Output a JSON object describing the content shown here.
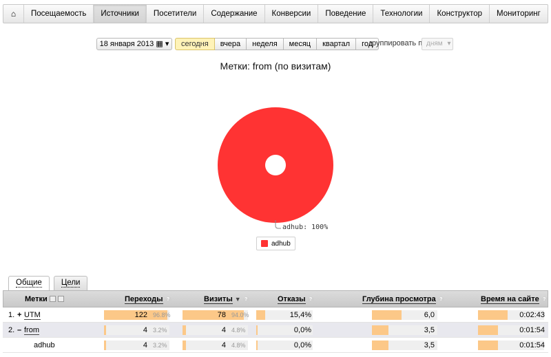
{
  "nav": {
    "home_icon": "house-icon",
    "items": [
      "Посещаемость",
      "Источники",
      "Посетители",
      "Содержание",
      "Конверсии",
      "Поведение",
      "Технологии",
      "Конструктор",
      "Мониторинг"
    ],
    "active": "Источники"
  },
  "controls": {
    "date": "18 января 2013",
    "periods": [
      "сегодня",
      "вчера",
      "неделя",
      "месяц",
      "квартал",
      "год"
    ],
    "active_period": "сегодня",
    "group_label": "группировать по",
    "group_value": "дням"
  },
  "chart_data": {
    "type": "pie",
    "title": "Метки: from (по визитам)",
    "slices": [
      {
        "name": "adhub",
        "value": 100,
        "label": "adhub: 100%",
        "color": "#ff3333"
      }
    ],
    "legend": [
      "adhub"
    ],
    "legend_placement": "bottom"
  },
  "tabs": [
    "Общие",
    "Цели"
  ],
  "active_tab": "Общие",
  "table": {
    "headers": {
      "label": "Метки",
      "transitions": "Переходы",
      "visits": "Визиты",
      "bounces": "Отказы",
      "depth": "Глубина просмотра",
      "time": "Время на сайте"
    },
    "rows": [
      {
        "num": "1.",
        "toggle": "+",
        "label": "UTM",
        "transitions": "122",
        "transitions_pct": "96.8%",
        "transitions_frac": 0.968,
        "visits": "78",
        "visits_pct": "94.0%",
        "visits_frac": 0.94,
        "bounces": "15,4%",
        "bounces_frac": 0.154,
        "depth": "6,0",
        "depth_frac": 0.45,
        "time": "0:02:43",
        "time_frac": 0.45
      },
      {
        "num": "2.",
        "toggle": "–",
        "label": "from",
        "transitions": "4",
        "transitions_pct": "3.2%",
        "transitions_frac": 0.032,
        "visits": "4",
        "visits_pct": "4.8%",
        "visits_frac": 0.048,
        "bounces": "0,0%",
        "bounces_frac": 0.0,
        "depth": "3,5",
        "depth_frac": 0.25,
        "time": "0:01:54",
        "time_frac": 0.3
      },
      {
        "num": "",
        "toggle": "",
        "label": "adhub",
        "transitions": "4",
        "transitions_pct": "3.2%",
        "transitions_frac": 0.032,
        "visits": "4",
        "visits_pct": "4.8%",
        "visits_frac": 0.048,
        "bounces": "0,0%",
        "bounces_frac": 0.0,
        "depth": "3,5",
        "depth_frac": 0.25,
        "time": "0:01:54",
        "time_frac": 0.3
      }
    ]
  }
}
